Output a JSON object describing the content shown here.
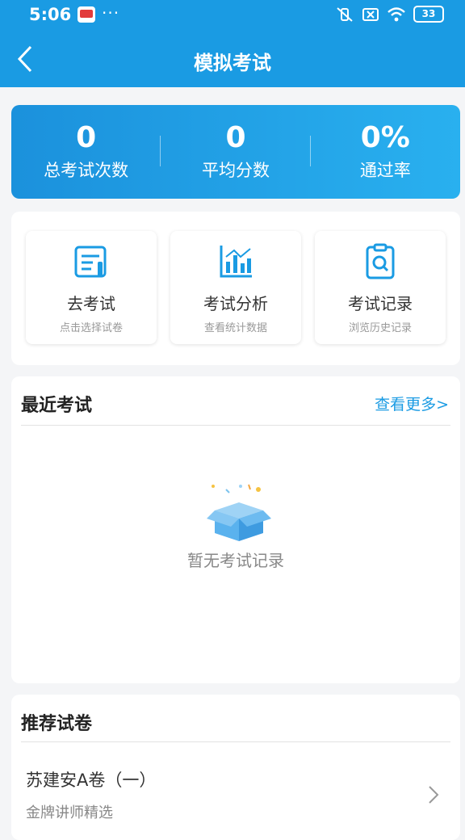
{
  "status_bar": {
    "time": "5:06",
    "dots": "···",
    "battery": "33"
  },
  "nav": {
    "title": "模拟考试"
  },
  "stats": [
    {
      "value": "0",
      "label": "总考试次数"
    },
    {
      "value": "0",
      "label": "平均分数"
    },
    {
      "value": "0%",
      "label": "通过率"
    }
  ],
  "actions": [
    {
      "title": "去考试",
      "subtitle": "点击选择试卷",
      "icon": "exam-sheet-icon"
    },
    {
      "title": "考试分析",
      "subtitle": "查看统计数据",
      "icon": "bar-chart-icon"
    },
    {
      "title": "考试记录",
      "subtitle": "浏览历史记录",
      "icon": "record-search-icon"
    }
  ],
  "recent": {
    "title": "最近考试",
    "more": "查看更多>",
    "empty": "暂无考试记录"
  },
  "recommend": {
    "title": "推荐试卷",
    "papers": [
      {
        "title": "苏建安A卷（一）",
        "subtitle": "金牌讲师精选"
      }
    ]
  },
  "colors": {
    "primary": "#1a9be3"
  }
}
